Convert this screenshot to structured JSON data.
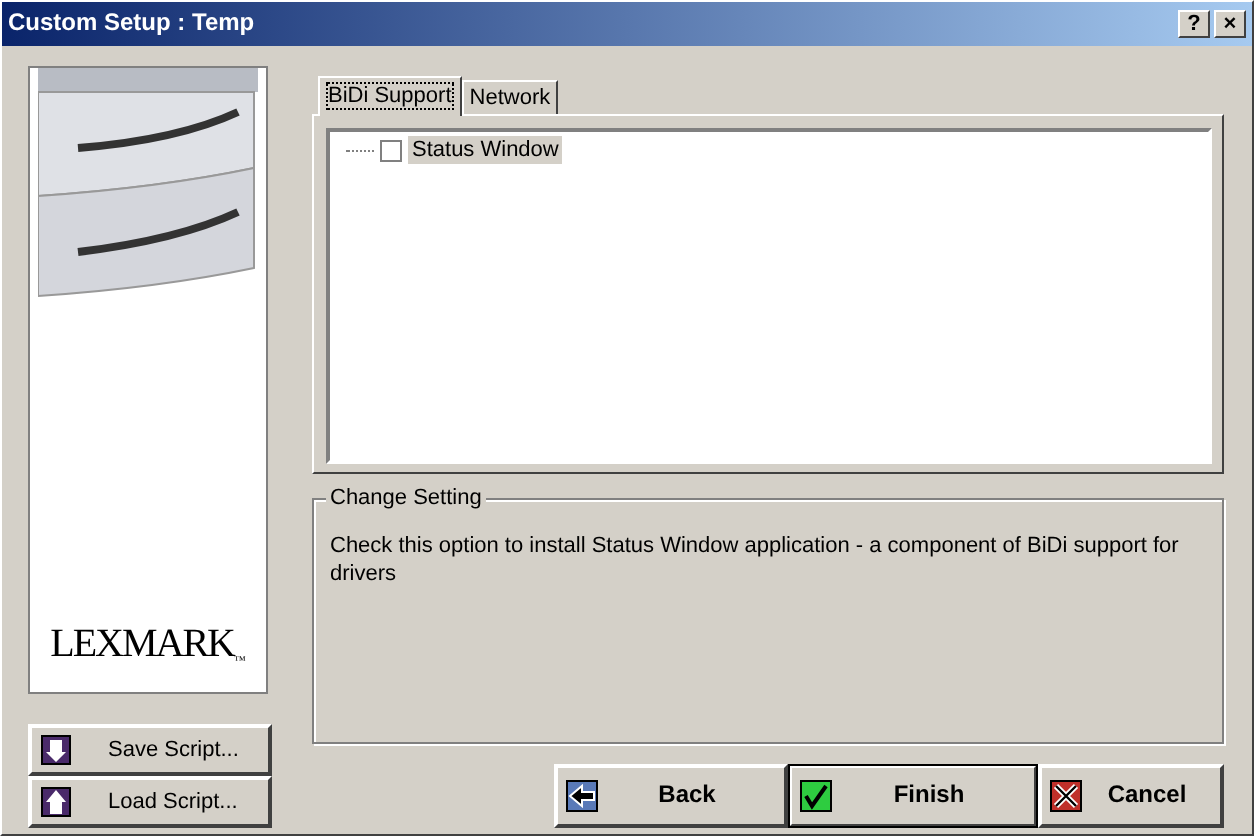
{
  "window": {
    "title": "Custom Setup : Temp",
    "controls": [
      "?",
      "×"
    ]
  },
  "logo": {
    "text": "LEXMARK",
    "mark": "™"
  },
  "tabs": [
    {
      "label": "BiDi Support",
      "selected": true
    },
    {
      "label": "Network",
      "selected": false
    }
  ],
  "tree": [
    {
      "label": "Status Window",
      "checked": false,
      "selected": true
    }
  ],
  "change_setting": {
    "title": "Change Setting",
    "text": "Check this option to install Status Window application - a component of BiDi support for drivers"
  },
  "script_buttons": [
    {
      "label": "Save Script...",
      "kind": "save"
    },
    {
      "label": "Load Script...",
      "kind": "load"
    }
  ],
  "buttons": [
    {
      "label": "Back",
      "kind": "back",
      "default": false
    },
    {
      "label": "Finish",
      "kind": "finish",
      "default": true
    },
    {
      "label": "Cancel",
      "kind": "cancel",
      "default": false
    }
  ]
}
